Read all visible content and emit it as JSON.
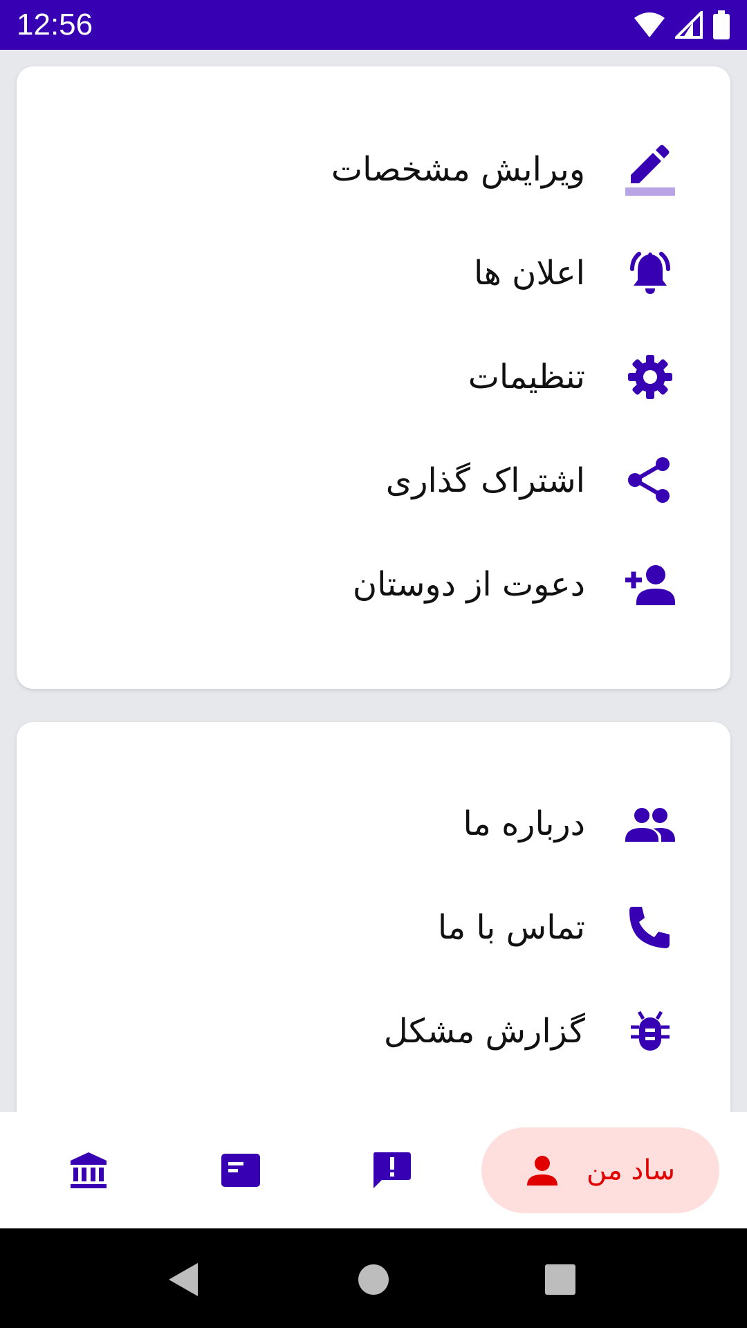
{
  "status_bar": {
    "time": "12:56",
    "icons": [
      "wifi-icon",
      "signal-icon",
      "battery-icon"
    ],
    "background": "#3700b3"
  },
  "accent_color": "#3700b3",
  "card1": {
    "items": [
      {
        "label": "ویرایش مشخصات",
        "icon": "edit-icon"
      },
      {
        "label": "اعلان ها",
        "icon": "notification-bell-icon"
      },
      {
        "label": "تنظیمات",
        "icon": "gear-icon"
      },
      {
        "label": "اشتراک گذاری",
        "icon": "share-icon"
      },
      {
        "label": "دعوت از دوستان",
        "icon": "person-add-icon"
      }
    ]
  },
  "card2": {
    "items": [
      {
        "label": "درباره ما",
        "icon": "people-icon"
      },
      {
        "label": "تماس با ما",
        "icon": "phone-icon"
      },
      {
        "label": "گزارش مشکل",
        "icon": "bug-icon"
      }
    ]
  },
  "bottom_nav": {
    "items": [
      {
        "icon": "bank-icon"
      },
      {
        "icon": "article-icon"
      },
      {
        "icon": "feedback-icon"
      }
    ],
    "active": {
      "label": "ساد من",
      "icon": "person-icon",
      "color": "#e00000",
      "background": "#ffdede"
    }
  },
  "system_nav": {
    "buttons": [
      "back-icon",
      "home-icon",
      "recents-icon"
    ]
  }
}
